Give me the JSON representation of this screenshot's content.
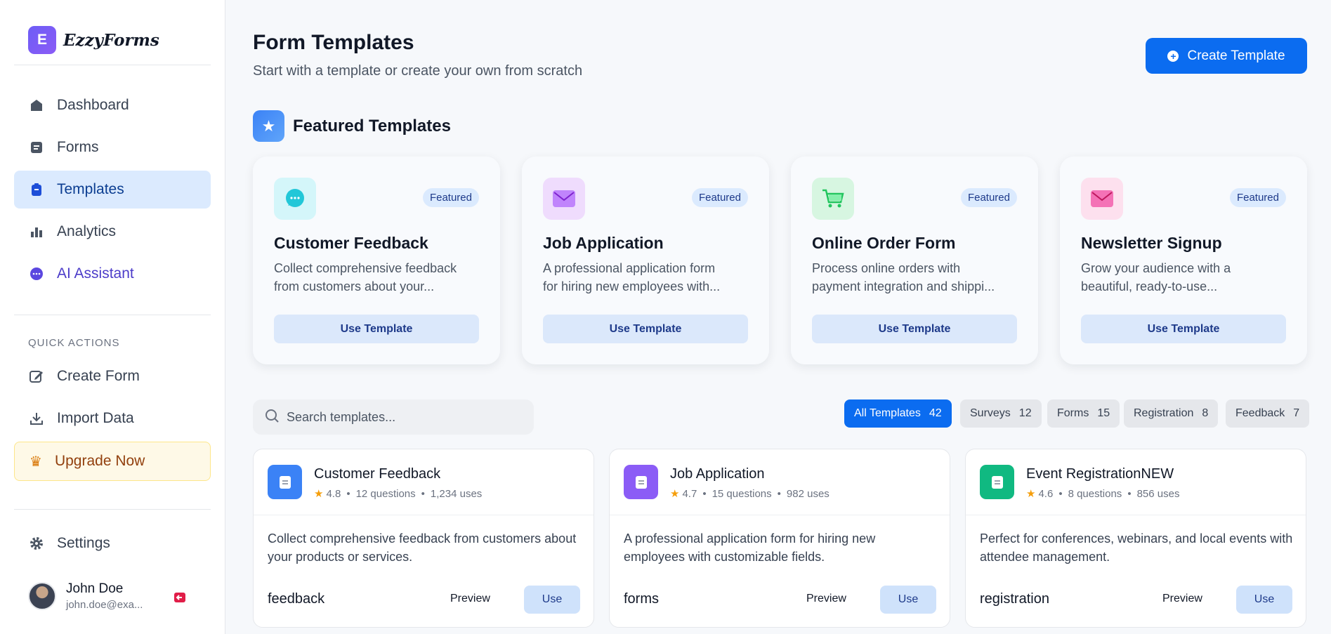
{
  "brand": {
    "logo_letter": "E",
    "name": "EzzyForms"
  },
  "sidebar": {
    "nav": [
      {
        "label": "Dashboard",
        "icon": "home-icon"
      },
      {
        "label": "Forms",
        "icon": "forms-icon"
      },
      {
        "label": "Templates",
        "icon": "clipboard-icon",
        "active": true
      },
      {
        "label": "Analytics",
        "icon": "bar-chart-icon"
      },
      {
        "label": "AI Assistant",
        "icon": "chat-bubble-icon"
      }
    ],
    "quick_actions_label": "QUICK ACTIONS",
    "quick_actions": [
      {
        "label": "Create Form",
        "icon": "edit-icon"
      },
      {
        "label": "Import Data",
        "icon": "download-icon"
      }
    ],
    "upgrade_label": "Upgrade Now",
    "settings_label": "Settings",
    "user": {
      "name": "John Doe",
      "email": "john.doe@exa..."
    }
  },
  "header": {
    "title": "Form Templates",
    "subtitle": "Start with a template or create your own from scratch",
    "create_button": "Create Template"
  },
  "featured": {
    "title": "Featured Templates",
    "cards": [
      {
        "title": "Customer Feedback",
        "badge": "Featured",
        "desc_line1": "Collect comprehensive feedback",
        "desc_line2": "from customers about your...",
        "button": "Use Template",
        "icon": "chat-icon",
        "color": "#22c7d8",
        "bg": "#d4f6fa"
      },
      {
        "title": "Job Application",
        "badge": "Featured",
        "desc_line1": "A professional application form",
        "desc_line2": "for hiring new employees with...",
        "button": "Use Template",
        "icon": "envelope-icon",
        "color": "#a855f7",
        "bg": "#efdcfd"
      },
      {
        "title": "Online Order Form",
        "badge": "Featured",
        "desc_line1": "Process online orders with",
        "desc_line2": "payment integration and shippi...",
        "button": "Use Template",
        "icon": "cart-icon",
        "color": "#22c55e",
        "bg": "#d7f6e1"
      },
      {
        "title": "Newsletter Signup",
        "badge": "Featured",
        "desc_line1": "Grow your audience with a",
        "desc_line2": "beautiful, ready-to-use...",
        "button": "Use Template",
        "icon": "envelope-icon",
        "color": "#ec4899",
        "bg": "#fde0ee"
      }
    ]
  },
  "search": {
    "placeholder": "Search templates..."
  },
  "filters": [
    {
      "label": "All Templates",
      "count": "42",
      "active": true
    },
    {
      "label": "Surveys",
      "count": "12"
    },
    {
      "label": "Forms",
      "count": "15"
    },
    {
      "label": "Registration",
      "count": "8"
    },
    {
      "label": "Feedback",
      "count": "7"
    }
  ],
  "templates": [
    {
      "name": "Customer Feedback",
      "rating": "4.8",
      "questions": "12 questions",
      "uses": "1,234 uses",
      "desc": "Collect comprehensive feedback from customers about your products or services.",
      "tag": "feedback",
      "preview": "Preview",
      "use": "Use",
      "color": "#3b82f6"
    },
    {
      "name": "Job Application",
      "rating": "4.7",
      "questions": "15 questions",
      "uses": "982 uses",
      "desc": "A professional application form for hiring new employees with customizable fields.",
      "tag": "forms",
      "preview": "Preview",
      "use": "Use",
      "color": "#8b5cf6"
    },
    {
      "name": "Event RegistrationNEW",
      "rating": "4.6",
      "questions": "8 questions",
      "uses": "856 uses",
      "desc": "Perfect for conferences, webinars, and local events with attendee management.",
      "tag": "registration",
      "preview": "Preview",
      "use": "Use",
      "color": "#10b981"
    }
  ]
}
